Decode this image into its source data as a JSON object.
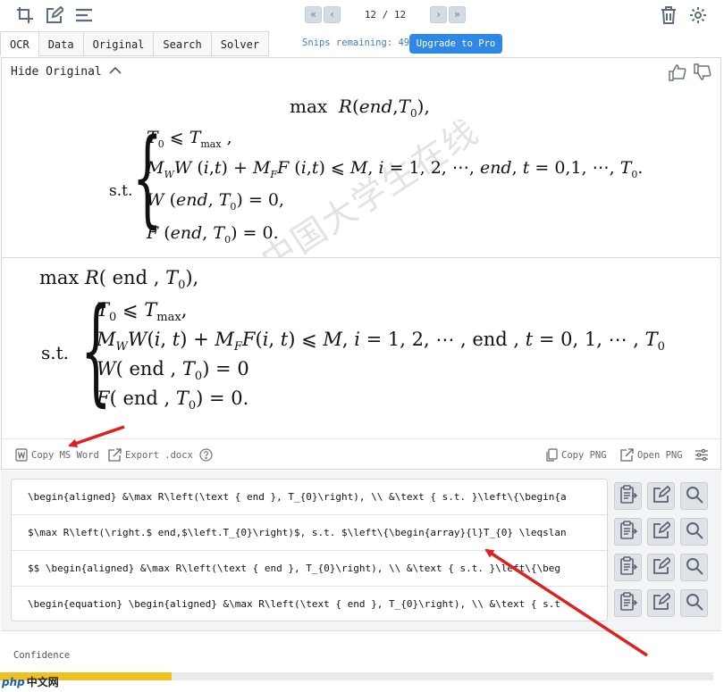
{
  "toolbar": {
    "page_indicator": "12 / 12",
    "icons": [
      "crop-screen-icon",
      "edit-icon",
      "menu-icon",
      "first-page-icon",
      "prev-page-icon",
      "next-page-icon",
      "last-page-icon",
      "trash-icon",
      "settings-icon"
    ]
  },
  "tabs": [
    {
      "label": "OCR",
      "active": true
    },
    {
      "label": "Data"
    },
    {
      "label": "Original"
    },
    {
      "label": "Search"
    },
    {
      "label": "Solver"
    }
  ],
  "snips_remaining": "Snips remaining: 49",
  "upgrade_label": "Upgrade to Pro",
  "hide_original_label": "Hide Original",
  "original_image": {
    "watermark": "中国大学生在线",
    "st": "s.t."
  },
  "actions": {
    "copy_word": "Copy MS Word",
    "export_docx": "Export .docx",
    "copy_png": "Copy PNG",
    "open_png": "Open PNG"
  },
  "results": [
    "\\begin{aligned} &\\max R\\left(\\text { end }, T_{0}\\right), \\\\ &\\text { s.t. }\\left\\{\\begin{a",
    "$\\max R\\left(\\right.$ end,$\\left.T_{0}\\right)$, s.t. $\\left\\{\\begin{array}{l}T_{0} \\leqslan",
    "$$  \\begin{aligned} &\\max R\\left(\\text { end }, T_{0}\\right), \\\\ &\\text { s.t. }\\left\\{\\beg",
    "\\begin{equation}  \\begin{aligned} &\\max R\\left(\\text { end }, T_{0}\\right), \\\\ &\\text { s.t"
  ],
  "confidence_label": "Confidence",
  "confidence_value": 0.24,
  "logo_text": "中文网",
  "logo_mark": "php",
  "colors": {
    "accent": "#2d88e6",
    "confidence_fill": "#f0c020",
    "arrow": "#e02020"
  }
}
